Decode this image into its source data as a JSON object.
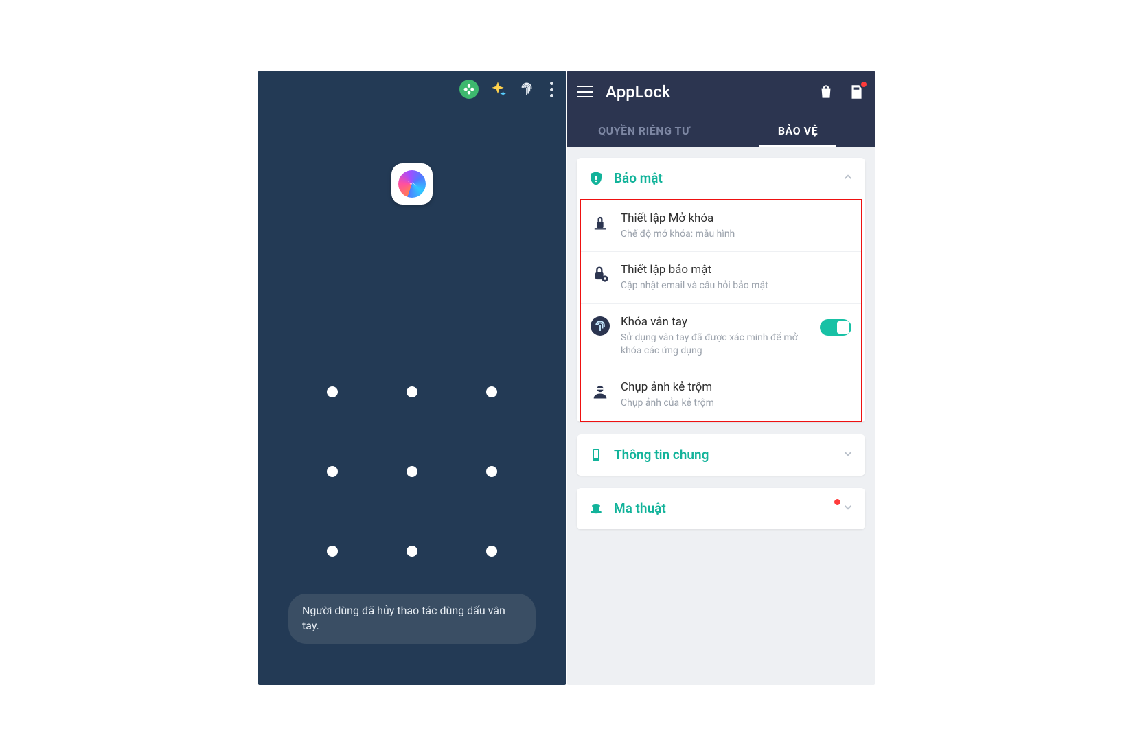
{
  "left": {
    "toast": "Người dùng đã hủy thao tác dùng dấu vân tay."
  },
  "right": {
    "title": "AppLock",
    "tabs": {
      "privacy": "QUYỀN RIÊNG TƯ",
      "protect": "BẢO VỆ"
    },
    "cards": {
      "security": {
        "title": "Bảo mật",
        "items": {
          "unlock": {
            "title": "Thiết lập Mở khóa",
            "sub": "Chế độ mở khóa: mẫu hình"
          },
          "secset": {
            "title": "Thiết lập bảo mật",
            "sub": "Cập nhật email và câu hỏi bảo mật"
          },
          "finger": {
            "title": "Khóa vân tay",
            "sub": "Sử dụng vân tay đã được xác minh để mở khóa các ứng dụng"
          },
          "thief": {
            "title": "Chụp ảnh kẻ trộm",
            "sub": "Chụp ảnh của kẻ trộm"
          }
        }
      },
      "general": {
        "title": "Thông tin chung"
      },
      "magic": {
        "title": "Ma thuật"
      }
    }
  }
}
